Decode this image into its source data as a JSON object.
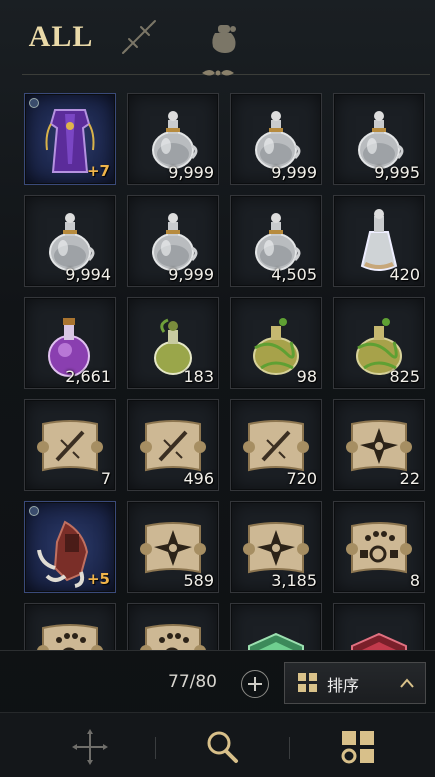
{
  "tabs": {
    "all_label": "ALL",
    "icons": [
      "sword-icon",
      "pouch-icon"
    ]
  },
  "inventory": {
    "items": [
      {
        "icon": "purple-robe-icon",
        "qty": "",
        "enhance": "+7",
        "quality": "blue",
        "gem": true
      },
      {
        "icon": "clear-flask-icon",
        "qty": "9,999"
      },
      {
        "icon": "clear-flask-icon",
        "qty": "9,999"
      },
      {
        "icon": "clear-flask-icon",
        "qty": "9,995"
      },
      {
        "icon": "clear-flask-icon",
        "qty": "9,994"
      },
      {
        "icon": "clear-flask-icon",
        "qty": "9,999"
      },
      {
        "icon": "clear-flask-icon",
        "qty": "4,505"
      },
      {
        "icon": "tall-bottle-icon",
        "qty": "420"
      },
      {
        "icon": "purple-potion-icon",
        "qty": "2,661"
      },
      {
        "icon": "green-potion-icon",
        "qty": "183"
      },
      {
        "icon": "vine-potion-icon",
        "qty": "98"
      },
      {
        "icon": "vine-potion-icon",
        "qty": "825"
      },
      {
        "icon": "slash-scroll-icon",
        "qty": "7"
      },
      {
        "icon": "slash-scroll-icon",
        "qty": "496"
      },
      {
        "icon": "slash-scroll-icon",
        "qty": "720"
      },
      {
        "icon": "star-scroll-icon",
        "qty": "22"
      },
      {
        "icon": "claw-gauntlet-icon",
        "qty": "",
        "enhance": "+5",
        "quality": "blue",
        "gem": true
      },
      {
        "icon": "star-scroll-icon",
        "qty": "589"
      },
      {
        "icon": "star-scroll-icon",
        "qty": "3,185"
      },
      {
        "icon": "rune-scroll-icon",
        "qty": "8"
      },
      {
        "icon": "rune-scroll-icon",
        "qty": ""
      },
      {
        "icon": "rune-scroll-icon",
        "qty": ""
      },
      {
        "icon": "green-crystal-icon",
        "qty": ""
      },
      {
        "icon": "red-crystal-icon",
        "qty": ""
      }
    ]
  },
  "footer": {
    "count": "77/80",
    "sort_label": "排序"
  },
  "bottom_bar": {
    "icons": [
      "move-cross-icon",
      "magnifier-icon",
      "grid-gear-icon"
    ]
  },
  "colors": {
    "accent_gold": "#e9d9a8",
    "enhance_orange": "#f0b44a",
    "blue_quality": "#2b3a6a"
  }
}
